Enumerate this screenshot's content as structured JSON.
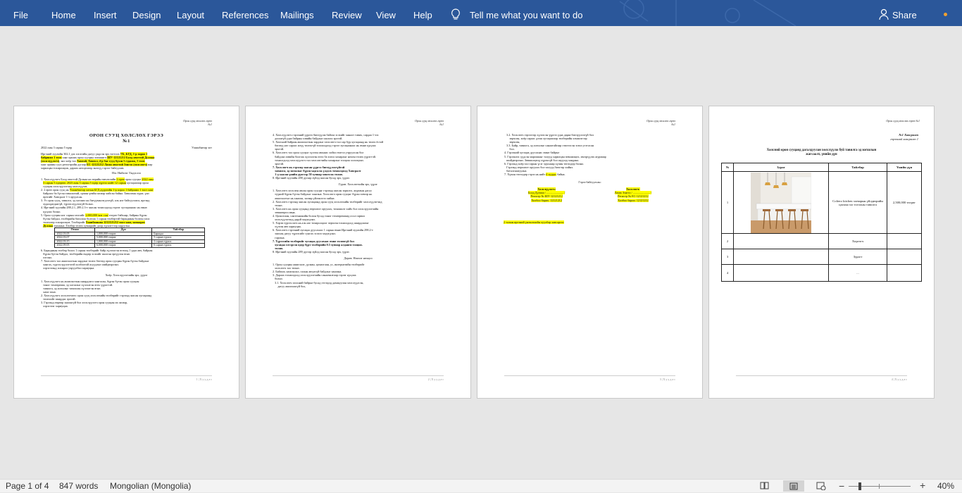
{
  "ribbon": {
    "menus": [
      "File",
      "Home",
      "Insert",
      "Design",
      "Layout",
      "References",
      "Mailings",
      "Review",
      "View",
      "Help"
    ],
    "tell_me": "Tell me what you want to do",
    "share": "Share",
    "color": "#2b579a"
  },
  "pages": {
    "header": "Орон сууц хөлслөх гэрээ\n№1",
    "p1": {
      "title": "ОРОН СУУЦ ХӨЛСЛӨХ ГЭРЭЭ",
      "number": "№1",
      "date": "2022 оны 3 сарын 5 өдөр",
      "city": "Улаанбаатар хот",
      "section": "Нэг. Нийтлэг Үндэслэл",
      "footer": "1 | Х у у д а с",
      "table_headers": [
        "Огноо",
        "Дүн",
        "Тайлбар"
      ],
      "table_rows": [
        [
          "2022.03.05",
          "1,000,000 төгрөг",
          "Барьцаа"
        ],
        [
          "2022.03.07",
          "5,000,000 төгрөг",
          "5 сарын түрээс"
        ],
        [
          "2022.03.15",
          "1,000,000 төгрөг",
          "1 сарын түрээс"
        ],
        [
          "2022.09.05",
          "6,000,000 төгрөг",
          "6 сарын түрээс"
        ]
      ],
      "section2": "Хоёр. Хөлслүүлэгчийн эрх, үүрэг"
    },
    "p2": {
      "section3": "Гурав. Хөлслөгчийн эрх, үүрэг",
      "section4": "Дөрөв. Нэмэлт нөхцөл",
      "footer": "2 | Х у у д а с"
    },
    "p3": {
      "signed": "Гэрээ байгуулсан:",
      "left_title": "Хөлслүүлэгч:",
      "right_title": "Хөлслөгч:",
      "left_lines": [
        "Болд Дулмаа / ....................... /",
        "Регистр № ШУ-12121212",
        "Холбоо барих: 12121212"
      ],
      "right_lines": [
        "Ламж Зэнгэо / ....................... /",
        "Регистр № ЕС-12121212",
        "Холбоо барих: 12121212"
      ],
      "note": "2 талын иргэний үнэмлэхийн хуулбар хавсаргах",
      "footer": "3 | Х у у д а с"
    },
    "p4": {
      "annex_no": "№1 Хавсралт",
      "annex_sub": "гэрээний хавсралт 1",
      "title": "Хөлсний орон сууцанд дагалдуулан хөлслүүлж буй тавилга эд хогшлын жагсаалт, үнийн дүн",
      "headers": [
        "№",
        "Зураг",
        "Тайлбар",
        "Үнийн дүн"
      ],
      "rows": [
        {
          "no": "1",
          "desc": "Coltero kitchen загварын үйлдвэрийн цагаан гал тогооны тавилга",
          "price": "2,500,000 төгрөг"
        },
        {
          "no": "2",
          "desc": "Хөргөгч",
          "price": ""
        },
        {
          "no": "3",
          "desc": "Зурагт",
          "price": ""
        },
        {
          "no": "4",
          "desc": "...",
          "price": ""
        }
      ],
      "footer": "4 | Х у у д а с"
    }
  },
  "status": {
    "page": "Page 1 of 4",
    "words": "847 words",
    "language": "Mongolian (Mongolia)",
    "zoom": "40%"
  }
}
